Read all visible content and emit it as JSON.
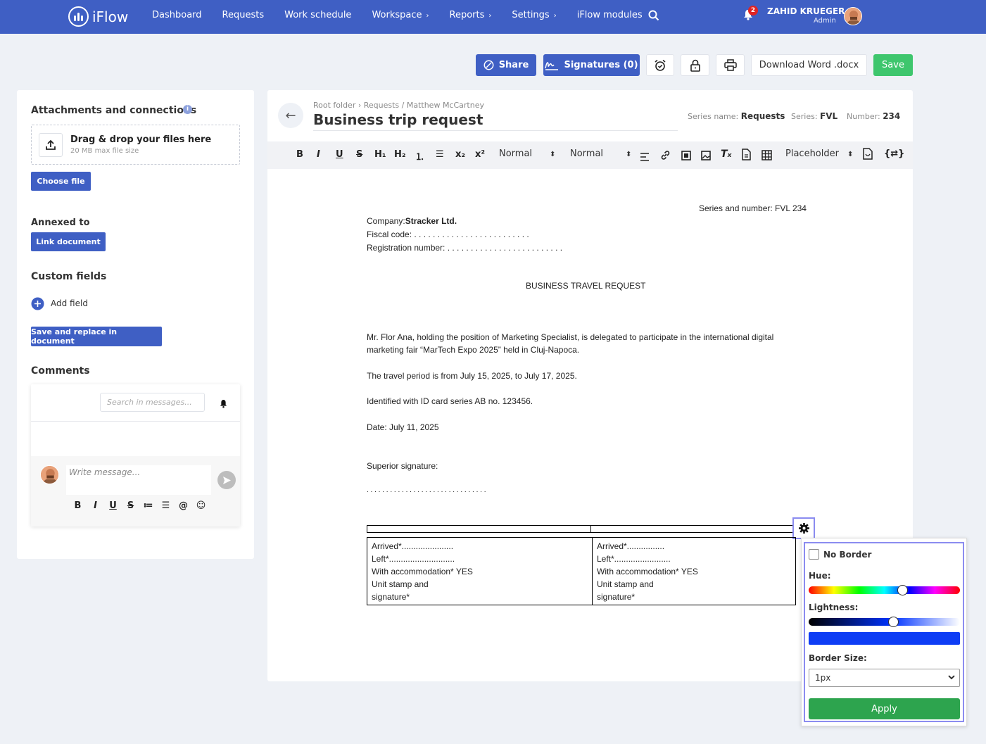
{
  "brand": "iFlow",
  "nav": {
    "items": [
      {
        "label": "Dashboard",
        "has_chevron": false
      },
      {
        "label": "Requests",
        "has_chevron": false
      },
      {
        "label": "Work schedule",
        "has_chevron": false
      },
      {
        "label": "Workspace",
        "has_chevron": true
      },
      {
        "label": "Reports",
        "has_chevron": true
      },
      {
        "label": "Settings",
        "has_chevron": true
      },
      {
        "label": "iFlow modules",
        "has_chevron": false
      }
    ],
    "chevron": "›",
    "notifications_count": "2"
  },
  "user": {
    "name": "ZAHID KRUEGER",
    "role": "Admin"
  },
  "actions": {
    "share": "Share",
    "signatures": "Signatures (0)",
    "download": "Download Word .docx",
    "save": "Save"
  },
  "attachments": {
    "title": "Attachments and connections",
    "info": "i",
    "drop_text": "Drag & drop your files here",
    "drop_sub": "20 MB max file size",
    "choose_file": "Choose file",
    "annexed_title": "Annexed to",
    "link_document": "Link document",
    "custom_fields_title": "Custom fields",
    "add_field": "Add field",
    "save_replace": "Save and replace in document",
    "comments_title": "Comments",
    "search_placeholder": "Search in messages...",
    "message_placeholder": "Write message..."
  },
  "comment_toolbar": [
    "B",
    "I",
    "U",
    "S",
    "≔",
    "☰",
    "@",
    "☺"
  ],
  "document": {
    "breadcrumb": "Root folder  ›  Requests / Matthew McCartney",
    "title": "Business trip request",
    "series_name_label": "Series name:",
    "series_name_value": "Requests",
    "series_label": "Series:",
    "series_value": "FVL",
    "number_label": "Number:",
    "number_value": "234"
  },
  "editor_toolbar": {
    "buttons": [
      "B",
      "I",
      "U",
      "S",
      "H₁",
      "H₂",
      "⒈",
      "☰",
      "x₂",
      "x²"
    ],
    "select1": "Normal",
    "select2": "Normal",
    "placeholder": "Placeholder"
  },
  "content": {
    "series_number": "Series and number: FVL 234",
    "company_label": "Company:",
    "company_value": "Stracker Ltd.",
    "fiscal_code": "Fiscal code:  . . . . . . . . . . . . . . . . . . . . . . . . .",
    "registration": "Registration number:  . . . . . . . . . . . . . . . . . . . . . . . . .",
    "heading": "BUSINESS TRAVEL REQUEST",
    "para1a": "Mr. Flor Ana, holding the position of Marketing Specialist, is delegated to participate in the international digital",
    "para1b": "marketing fair “MarTech Expo 2025” held in Cluj-Napoca.",
    "para2": "The travel period is from July 15, 2025, to July 17, 2025.",
    "para3": "Identified with ID card series AB no. 123456.",
    "para4": "Date: July 11, 2025",
    "superior": "Superior signature:",
    "sig_dots": ". . . . . . . . . . . . . . . . . . . . . . . . . . . . . . .",
    "col1": [
      "Arrived*......................",
      "Left*............................",
      "With accommodation* YES",
      "Unit stamp and",
      "signature*"
    ],
    "col2": [
      "Arrived*................",
      "Left*........................",
      "With accommodation* YES",
      "Unit stamp and",
      "signature*"
    ]
  },
  "border_popover": {
    "no_border": "No Border",
    "hue": "Hue:",
    "lightness": "Lightness:",
    "hue_value": 0.62,
    "lightness_value": 0.56,
    "color": "#0e3df5",
    "border_size_label": "Border Size:",
    "border_size_value": "1px",
    "apply": "Apply"
  },
  "colors": {
    "primary": "#3f5fc4",
    "save": "#3ec66d",
    "apply": "#2da44e",
    "highlight": "#8b8cf0"
  }
}
